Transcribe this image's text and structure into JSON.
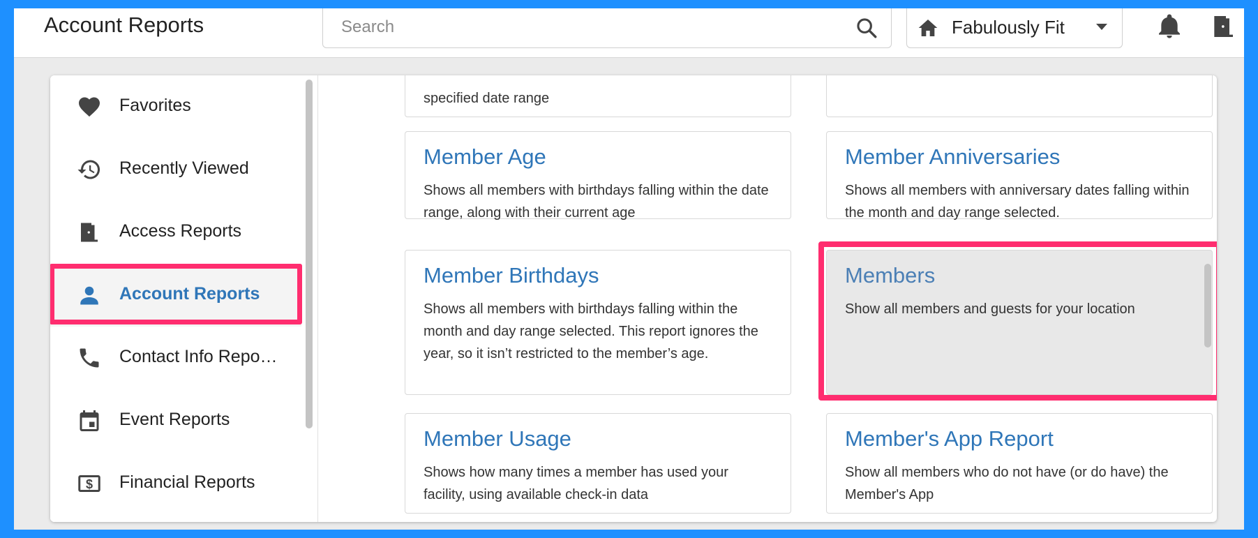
{
  "header": {
    "title": "Account Reports",
    "search_placeholder": "Search",
    "location": "Fabulously Fit"
  },
  "sidebar": {
    "items": [
      {
        "label": "Favorites",
        "icon": "heart-icon"
      },
      {
        "label": "Recently Viewed",
        "icon": "history-icon"
      },
      {
        "label": "Access Reports",
        "icon": "door-icon"
      },
      {
        "label": "Account Reports",
        "icon": "person-icon",
        "active": true
      },
      {
        "label": "Contact Info Repo…",
        "icon": "phone-icon"
      },
      {
        "label": "Event Reports",
        "icon": "calendar-icon"
      },
      {
        "label": "Financial Reports",
        "icon": "dollar-icon"
      }
    ]
  },
  "cards": {
    "partial_left_desc": "specified date range",
    "member_age": {
      "title": "Member Age",
      "desc": "Shows all members with birthdays falling within the date range, along with their current age"
    },
    "member_anniversaries": {
      "title": "Member Anniversaries",
      "desc": "Shows all members with anniversary dates falling within the month and day range selected."
    },
    "member_birthdays": {
      "title": "Member Birthdays",
      "desc": "Shows all members with birthdays falling within the month and day range selected. This report ignores the year, so it isn’t restricted to the member’s age."
    },
    "members": {
      "title": "Members",
      "desc": "Show all members and guests for your location"
    },
    "member_usage": {
      "title": "Member Usage",
      "desc": "Shows how many times a member has used your facility, using available check-in data"
    },
    "members_app": {
      "title": "Member's App Report",
      "desc": "Show all members who do not have (or do have) the Member's App"
    }
  },
  "colors": {
    "frame": "#1e90ff",
    "highlight": "#ff2d6f",
    "link": "#2f76b8"
  }
}
